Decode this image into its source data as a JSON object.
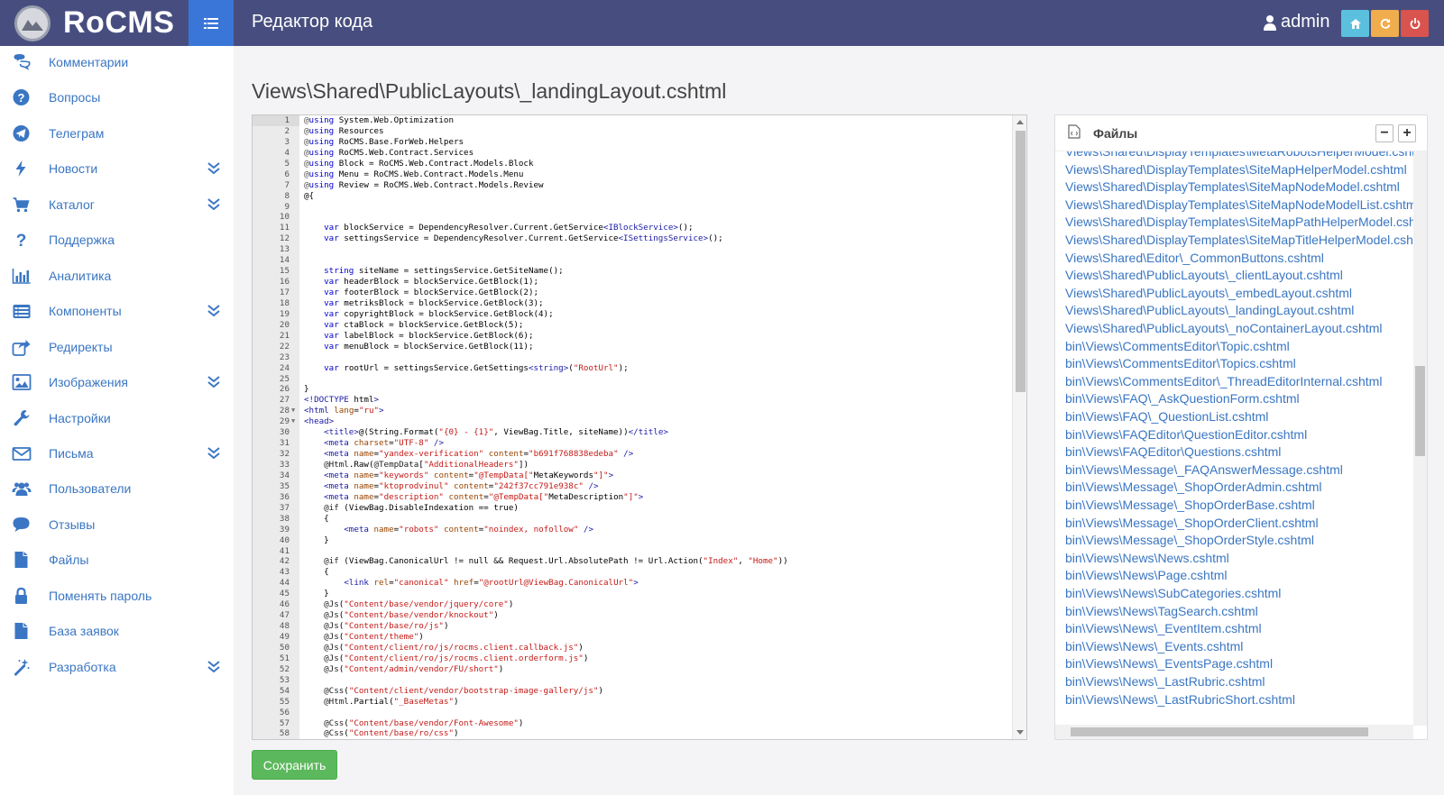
{
  "app": {
    "brand": "RoCMS"
  },
  "header": {
    "title": "Редактор кода",
    "user": "admin"
  },
  "sidebar": {
    "items": [
      {
        "label": "Комментарии",
        "icon": "comments-icon",
        "expandable": false
      },
      {
        "label": "Вопросы",
        "icon": "question-circle-icon",
        "expandable": false
      },
      {
        "label": "Телеграм",
        "icon": "telegram-icon",
        "expandable": false
      },
      {
        "label": "Новости",
        "icon": "bolt-icon",
        "expandable": true
      },
      {
        "label": "Каталог",
        "icon": "cart-icon",
        "expandable": true
      },
      {
        "label": "Поддержка",
        "icon": "question-icon",
        "expandable": false
      },
      {
        "label": "Аналитика",
        "icon": "bar-chart-icon",
        "expandable": false
      },
      {
        "label": "Компоненты",
        "icon": "list-alt-icon",
        "expandable": true
      },
      {
        "label": "Редиректы",
        "icon": "share-icon",
        "expandable": false
      },
      {
        "label": "Изображения",
        "icon": "image-icon",
        "expandable": true
      },
      {
        "label": "Настройки",
        "icon": "wrench-icon",
        "expandable": false
      },
      {
        "label": "Письма",
        "icon": "envelope-icon",
        "expandable": true
      },
      {
        "label": "Пользователи",
        "icon": "users-icon",
        "expandable": false
      },
      {
        "label": "Отзывы",
        "icon": "comment-icon",
        "expandable": false
      },
      {
        "label": "Файлы",
        "icon": "file-icon",
        "expandable": false
      },
      {
        "label": "Поменять пароль",
        "icon": "lock-icon",
        "expandable": false
      },
      {
        "label": "База заявок",
        "icon": "file-icon",
        "expandable": false
      },
      {
        "label": "Разработка",
        "icon": "magic-wand-icon",
        "expandable": true
      }
    ]
  },
  "editor": {
    "file_path": "Views\\Shared\\PublicLayouts\\_landingLayout.cshtml",
    "save_label": "Сохранить",
    "lines": [
      "@using System.Web.Optimization",
      "@using Resources",
      "@using RoCMS.Base.ForWeb.Helpers",
      "@using RoCMS.Web.Contract.Services",
      "@using Block = RoCMS.Web.Contract.Models.Block",
      "@using Menu = RoCMS.Web.Contract.Models.Menu",
      "@using Review = RoCMS.Web.Contract.Models.Review",
      "@{",
      "",
      "",
      "    var blockService = DependencyResolver.Current.GetService<IBlockService>();",
      "    var settingsService = DependencyResolver.Current.GetService<ISettingsService>();",
      "",
      "",
      "    string siteName = settingsService.GetSiteName();",
      "    var headerBlock = blockService.GetBlock(1);",
      "    var footerBlock = blockService.GetBlock(2);",
      "    var metriksBlock = blockService.GetBlock(3);",
      "    var copyrightBlock = blockService.GetBlock(4);",
      "    var ctaBlock = blockService.GetBlock(5);",
      "    var labelBlock = blockService.GetBlock(6);",
      "    var menuBlock = blockService.GetBlock(11);",
      "",
      "    var rootUrl = settingsService.GetSettings<string>(\"RootUrl\");",
      "",
      "}",
      "<!DOCTYPE html>",
      "<html lang=\"ru\">",
      "<head>",
      "    <title>@(String.Format(\"{0} - {1}\", ViewBag.Title, siteName))</title>",
      "    <meta charset=\"UTF-8\" />",
      "    <meta name=\"yandex-verification\" content=\"b691f768838edeba\" />",
      "    @Html.Raw(@TempData[\"AdditionalHeaders\"])",
      "    <meta name=\"keywords\" content=\"@TempData[\"MetaKeywords\"]\">",
      "    <meta name=\"ktoprodvinul\" content=\"242f37cc791e938c\" />",
      "    <meta name=\"description\" content=\"@TempData[\"MetaDescription\"]\">",
      "    @if (ViewBag.DisableIndexation == true)",
      "    {",
      "        <meta name=\"robots\" content=\"noindex, nofollow\" />",
      "    }",
      "",
      "    @if (ViewBag.CanonicalUrl != null && Request.Url.AbsolutePath != Url.Action(\"Index\", \"Home\"))",
      "    {",
      "        <link rel=\"canonical\" href=\"@rootUrl@ViewBag.CanonicalUrl\">",
      "    }",
      "    @Js(\"Content/base/vendor/jquery/core\")",
      "    @Js(\"Content/base/vendor/knockout\")",
      "    @Js(\"Content/base/ro/js\")",
      "    @Js(\"Content/theme\")",
      "    @Js(\"Content/client/ro/js/rocms.client.callback.js\")",
      "    @Js(\"Content/client/ro/js/rocms.client.orderform.js\")",
      "    @Js(\"Content/admin/vendor/FU/short\")",
      "",
      "    @Css(\"Content/client/vendor/bootstrap-image-gallery/js\")",
      "    @Html.Partial(\"_BaseMetas\")",
      "",
      "    @Css(\"Content/base/vendor/Font-Awesome\")",
      "    @Css(\"Content/base/ro/css\")"
    ],
    "fold_lines": [
      28,
      29
    ]
  },
  "files_panel": {
    "title": "Файлы",
    "minus_label": "−",
    "plus_label": "+",
    "files": [
      "Views\\Shared\\DisplayTemplates\\MetaRobotsHelperModel.cshtml",
      "Views\\Shared\\DisplayTemplates\\SiteMapHelperModel.cshtml",
      "Views\\Shared\\DisplayTemplates\\SiteMapNodeModel.cshtml",
      "Views\\Shared\\DisplayTemplates\\SiteMapNodeModelList.cshtml",
      "Views\\Shared\\DisplayTemplates\\SiteMapPathHelperModel.cshtml",
      "Views\\Shared\\DisplayTemplates\\SiteMapTitleHelperModel.cshtml",
      "Views\\Shared\\Editor\\_CommonButtons.cshtml",
      "Views\\Shared\\PublicLayouts\\_clientLayout.cshtml",
      "Views\\Shared\\PublicLayouts\\_embedLayout.cshtml",
      "Views\\Shared\\PublicLayouts\\_landingLayout.cshtml",
      "Views\\Shared\\PublicLayouts\\_noContainerLayout.cshtml",
      "bin\\Views\\CommentsEditor\\Topic.cshtml",
      "bin\\Views\\CommentsEditor\\Topics.cshtml",
      "bin\\Views\\CommentsEditor\\_ThreadEditorInternal.cshtml",
      "bin\\Views\\FAQ\\_AskQuestionForm.cshtml",
      "bin\\Views\\FAQ\\_QuestionList.cshtml",
      "bin\\Views\\FAQEditor\\QuestionEditor.cshtml",
      "bin\\Views\\FAQEditor\\Questions.cshtml",
      "bin\\Views\\Message\\_FAQAnswerMessage.cshtml",
      "bin\\Views\\Message\\_ShopOrderAdmin.cshtml",
      "bin\\Views\\Message\\_ShopOrderBase.cshtml",
      "bin\\Views\\Message\\_ShopOrderClient.cshtml",
      "bin\\Views\\Message\\_ShopOrderStyle.cshtml",
      "bin\\Views\\News\\News.cshtml",
      "bin\\Views\\News\\Page.cshtml",
      "bin\\Views\\News\\SubCategories.cshtml",
      "bin\\Views\\News\\TagSearch.cshtml",
      "bin\\Views\\News\\_EventItem.cshtml",
      "bin\\Views\\News\\_Events.cshtml",
      "bin\\Views\\News\\_EventsPage.cshtml",
      "bin\\Views\\News\\_LastRubric.cshtml",
      "bin\\Views\\News\\_LastRubricShort.cshtml"
    ]
  },
  "colors": {
    "topbar": "#474e7f",
    "accent_blue": "#3a76d8",
    "link": "#3a76c3",
    "save": "#5cb85c"
  }
}
